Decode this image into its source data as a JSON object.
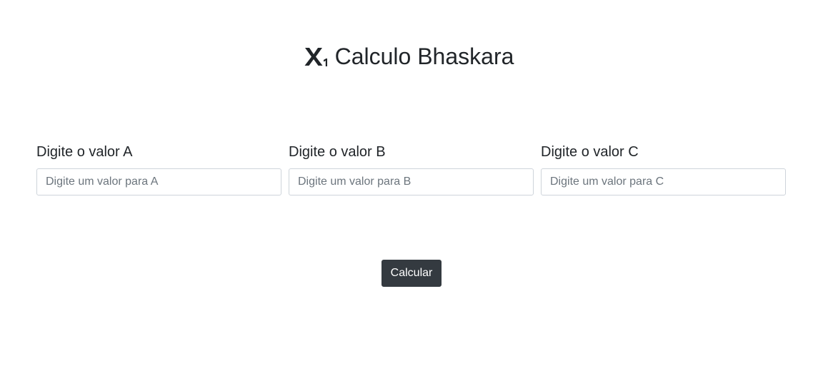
{
  "header": {
    "icon": "subscript-icon",
    "title": "Calculo Bhaskara"
  },
  "fields": [
    {
      "label": "Digite o valor A",
      "placeholder": "Digite um valor para A",
      "value": ""
    },
    {
      "label": "Digite o valor B",
      "placeholder": "Digite um valor para B",
      "value": ""
    },
    {
      "label": "Digite o valor C",
      "placeholder": "Digite um valor para C",
      "value": ""
    }
  ],
  "actions": {
    "calculate_label": "Calcular"
  },
  "colors": {
    "text": "#212529",
    "button_bg": "#343a40",
    "button_text": "#ffffff",
    "input_border": "#ced4da",
    "placeholder": "#6c757d",
    "background": "#ffffff"
  }
}
